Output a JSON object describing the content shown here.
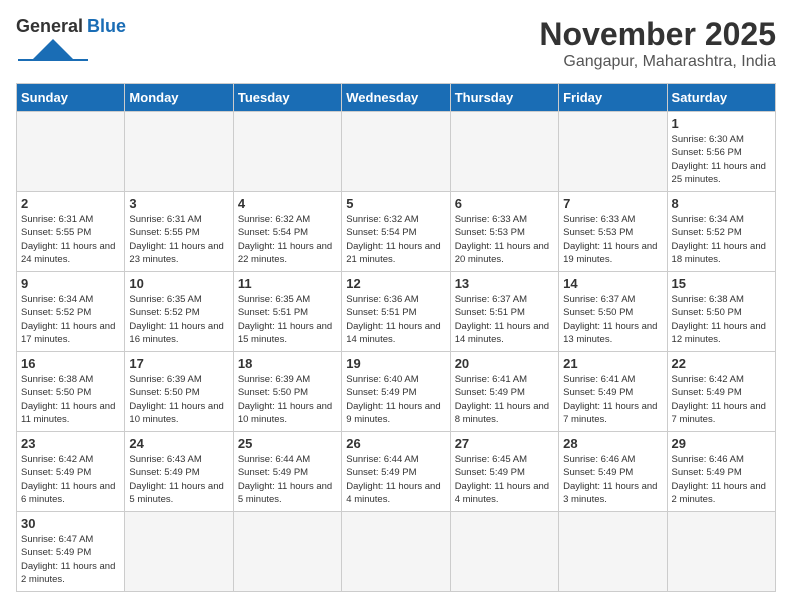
{
  "header": {
    "logo_general": "General",
    "logo_blue": "Blue",
    "title": "November 2025",
    "subtitle": "Gangapur, Maharashtra, India"
  },
  "calendar": {
    "days_of_week": [
      "Sunday",
      "Monday",
      "Tuesday",
      "Wednesday",
      "Thursday",
      "Friday",
      "Saturday"
    ],
    "weeks": [
      [
        {
          "day": "",
          "info": ""
        },
        {
          "day": "",
          "info": ""
        },
        {
          "day": "",
          "info": ""
        },
        {
          "day": "",
          "info": ""
        },
        {
          "day": "",
          "info": ""
        },
        {
          "day": "",
          "info": ""
        },
        {
          "day": "1",
          "info": "Sunrise: 6:30 AM\nSunset: 5:56 PM\nDaylight: 11 hours\nand 25 minutes."
        }
      ],
      [
        {
          "day": "2",
          "info": "Sunrise: 6:31 AM\nSunset: 5:55 PM\nDaylight: 11 hours\nand 24 minutes."
        },
        {
          "day": "3",
          "info": "Sunrise: 6:31 AM\nSunset: 5:55 PM\nDaylight: 11 hours\nand 23 minutes."
        },
        {
          "day": "4",
          "info": "Sunrise: 6:32 AM\nSunset: 5:54 PM\nDaylight: 11 hours\nand 22 minutes."
        },
        {
          "day": "5",
          "info": "Sunrise: 6:32 AM\nSunset: 5:54 PM\nDaylight: 11 hours\nand 21 minutes."
        },
        {
          "day": "6",
          "info": "Sunrise: 6:33 AM\nSunset: 5:53 PM\nDaylight: 11 hours\nand 20 minutes."
        },
        {
          "day": "7",
          "info": "Sunrise: 6:33 AM\nSunset: 5:53 PM\nDaylight: 11 hours\nand 19 minutes."
        },
        {
          "day": "8",
          "info": "Sunrise: 6:34 AM\nSunset: 5:52 PM\nDaylight: 11 hours\nand 18 minutes."
        }
      ],
      [
        {
          "day": "9",
          "info": "Sunrise: 6:34 AM\nSunset: 5:52 PM\nDaylight: 11 hours\nand 17 minutes."
        },
        {
          "day": "10",
          "info": "Sunrise: 6:35 AM\nSunset: 5:52 PM\nDaylight: 11 hours\nand 16 minutes."
        },
        {
          "day": "11",
          "info": "Sunrise: 6:35 AM\nSunset: 5:51 PM\nDaylight: 11 hours\nand 15 minutes."
        },
        {
          "day": "12",
          "info": "Sunrise: 6:36 AM\nSunset: 5:51 PM\nDaylight: 11 hours\nand 14 minutes."
        },
        {
          "day": "13",
          "info": "Sunrise: 6:37 AM\nSunset: 5:51 PM\nDaylight: 11 hours\nand 14 minutes."
        },
        {
          "day": "14",
          "info": "Sunrise: 6:37 AM\nSunset: 5:50 PM\nDaylight: 11 hours\nand 13 minutes."
        },
        {
          "day": "15",
          "info": "Sunrise: 6:38 AM\nSunset: 5:50 PM\nDaylight: 11 hours\nand 12 minutes."
        }
      ],
      [
        {
          "day": "16",
          "info": "Sunrise: 6:38 AM\nSunset: 5:50 PM\nDaylight: 11 hours\nand 11 minutes."
        },
        {
          "day": "17",
          "info": "Sunrise: 6:39 AM\nSunset: 5:50 PM\nDaylight: 11 hours\nand 10 minutes."
        },
        {
          "day": "18",
          "info": "Sunrise: 6:39 AM\nSunset: 5:50 PM\nDaylight: 11 hours\nand 10 minutes."
        },
        {
          "day": "19",
          "info": "Sunrise: 6:40 AM\nSunset: 5:49 PM\nDaylight: 11 hours\nand 9 minutes."
        },
        {
          "day": "20",
          "info": "Sunrise: 6:41 AM\nSunset: 5:49 PM\nDaylight: 11 hours\nand 8 minutes."
        },
        {
          "day": "21",
          "info": "Sunrise: 6:41 AM\nSunset: 5:49 PM\nDaylight: 11 hours\nand 7 minutes."
        },
        {
          "day": "22",
          "info": "Sunrise: 6:42 AM\nSunset: 5:49 PM\nDaylight: 11 hours\nand 7 minutes."
        }
      ],
      [
        {
          "day": "23",
          "info": "Sunrise: 6:42 AM\nSunset: 5:49 PM\nDaylight: 11 hours\nand 6 minutes."
        },
        {
          "day": "24",
          "info": "Sunrise: 6:43 AM\nSunset: 5:49 PM\nDaylight: 11 hours\nand 5 minutes."
        },
        {
          "day": "25",
          "info": "Sunrise: 6:44 AM\nSunset: 5:49 PM\nDaylight: 11 hours\nand 5 minutes."
        },
        {
          "day": "26",
          "info": "Sunrise: 6:44 AM\nSunset: 5:49 PM\nDaylight: 11 hours\nand 4 minutes."
        },
        {
          "day": "27",
          "info": "Sunrise: 6:45 AM\nSunset: 5:49 PM\nDaylight: 11 hours\nand 4 minutes."
        },
        {
          "day": "28",
          "info": "Sunrise: 6:46 AM\nSunset: 5:49 PM\nDaylight: 11 hours\nand 3 minutes."
        },
        {
          "day": "29",
          "info": "Sunrise: 6:46 AM\nSunset: 5:49 PM\nDaylight: 11 hours\nand 2 minutes."
        }
      ],
      [
        {
          "day": "30",
          "info": "Sunrise: 6:47 AM\nSunset: 5:49 PM\nDaylight: 11 hours\nand 2 minutes."
        },
        {
          "day": "",
          "info": ""
        },
        {
          "day": "",
          "info": ""
        },
        {
          "day": "",
          "info": ""
        },
        {
          "day": "",
          "info": ""
        },
        {
          "day": "",
          "info": ""
        },
        {
          "day": "",
          "info": ""
        }
      ]
    ]
  }
}
